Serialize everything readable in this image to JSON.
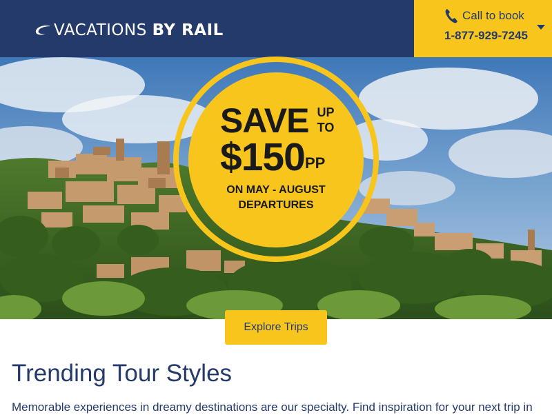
{
  "header": {
    "logo_part1": "VACATIONS",
    "logo_part2": "BY RAIL",
    "logo_icon": "swoosh-icon",
    "call_label": "Call to book",
    "call_number": "1-877-929-7245",
    "call_icon": "phone-icon",
    "dropdown_icon": "chevron-down-icon"
  },
  "promo": {
    "save": "SAVE",
    "upto_line1": "UP",
    "upto_line2": "TO",
    "amount": "$150",
    "suffix": "PP",
    "line1": "ON MAY - AUGUST",
    "line2": "DEPARTURES"
  },
  "cta": {
    "explore_label": "Explore Trips"
  },
  "section": {
    "title": "Trending Tour Styles",
    "text": "Memorable experiences in dreamy destinations are our specialty. Find inspiration for your next trip in"
  },
  "colors": {
    "navy": "#233a6b",
    "yellow": "#f8c51c"
  }
}
